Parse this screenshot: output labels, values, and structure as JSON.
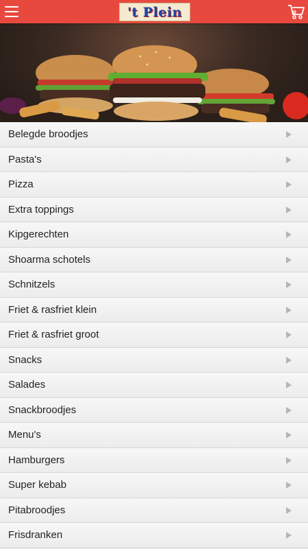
{
  "header": {
    "logo_text": "'t Plein",
    "menu_icon": "hamburger-menu-icon",
    "cart_icon": "shopping-cart-icon",
    "cart_count": "0",
    "bar_color": "#e8493f"
  },
  "hero": {
    "image": "burgers-and-fries-photo"
  },
  "categories": [
    {
      "label": "Belegde broodjes"
    },
    {
      "label": "Pasta's"
    },
    {
      "label": "Pizza"
    },
    {
      "label": "Extra toppings"
    },
    {
      "label": "Kipgerechten"
    },
    {
      "label": "Shoarma schotels"
    },
    {
      "label": "Schnitzels"
    },
    {
      "label": "Friet & rasfriet klein"
    },
    {
      "label": "Friet & rasfriet groot"
    },
    {
      "label": "Snacks"
    },
    {
      "label": "Salades"
    },
    {
      "label": "Snackbroodjes"
    },
    {
      "label": "Menu's"
    },
    {
      "label": "Hamburgers"
    },
    {
      "label": "Super kebab"
    },
    {
      "label": "Pitabroodjes"
    },
    {
      "label": "Frisdranken"
    }
  ]
}
